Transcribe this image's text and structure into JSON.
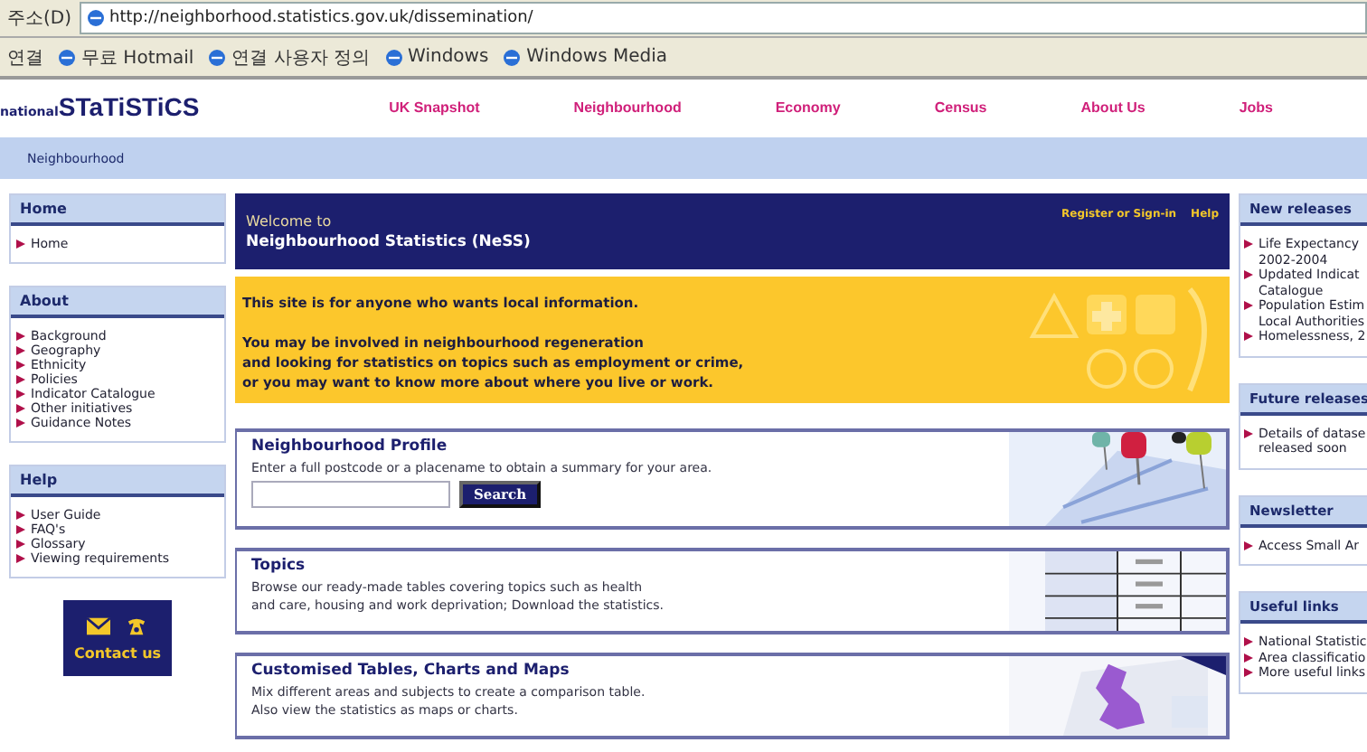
{
  "browser": {
    "address_label": "주소(D)",
    "url": "http://neighborhood.statistics.gov.uk/dissemination/",
    "links_label": "연결",
    "links": [
      "무료 Hotmail",
      "연결 사용자 정의",
      "Windows",
      "Windows Media"
    ]
  },
  "header": {
    "logo_small": "national",
    "logo_big": "STaTiSTiCS",
    "nav": [
      "UK Snapshot",
      "Neighbourhood",
      "Economy",
      "Census",
      "About Us",
      "Jobs"
    ]
  },
  "breadcrumb": "Neighbourhood",
  "left_sidebar": [
    {
      "title": "Home",
      "items": [
        "Home"
      ]
    },
    {
      "title": "About",
      "items": [
        "Background",
        "Geography",
        "Ethnicity",
        "Policies",
        "Indicator Catalogue",
        "Other initiatives",
        "Guidance Notes"
      ]
    },
    {
      "title": "Help",
      "items": [
        "User Guide",
        "FAQ's",
        "Glossary",
        "Viewing requirements"
      ]
    }
  ],
  "contact": "Contact us",
  "welcome": {
    "line1": "Welcome to",
    "line2": "Neighbourhood Statistics (NeSS)",
    "links": [
      "Register or Sign-in",
      "Help"
    ]
  },
  "intro": {
    "line1": "This site is for anyone who wants local information.",
    "lines": [
      "You may be involved in neighbourhood regeneration",
      "and looking for statistics on topics such as employment or crime,",
      "or you may want to know more about where you live or work."
    ]
  },
  "sections": [
    {
      "kind": "search",
      "title": "Neighbourhood Profile",
      "lines": [
        "Enter a full postcode or a placename to obtain a summary for your area."
      ],
      "button": "Search"
    },
    {
      "kind": "text",
      "title": "Topics",
      "lines": [
        "Browse our ready-made tables covering topics such as health",
        "and care, housing and work deprivation; Download the statistics."
      ]
    },
    {
      "kind": "text",
      "title": "Customised Tables, Charts and Maps",
      "lines": [
        "Mix different areas and subjects to create a comparison table.",
        "Also view the statistics as maps or charts."
      ]
    }
  ],
  "right_sidebar": [
    {
      "title": "New releases",
      "items": [
        [
          "Life Expectancy",
          "2002-2004"
        ],
        [
          "Updated Indicat",
          "Catalogue"
        ],
        [
          "Population Estim",
          "Local Authorities"
        ],
        [
          "Homelessness, 2"
        ]
      ]
    },
    {
      "title": "Future releases",
      "items": [
        [
          "Details of datase",
          "released soon"
        ]
      ]
    },
    {
      "title": "Newsletter",
      "items": [
        [
          "Access Small Ar"
        ]
      ]
    },
    {
      "title": "Useful links",
      "items": [
        [
          "National Statistic"
        ],
        [
          "Area classificatio"
        ],
        [
          "More useful links"
        ]
      ]
    }
  ]
}
